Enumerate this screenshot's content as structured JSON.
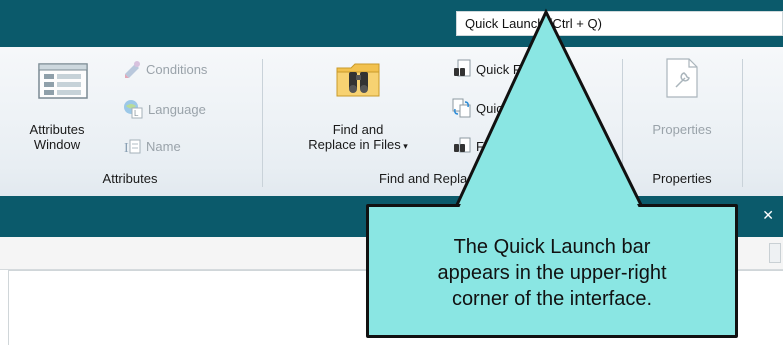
{
  "quick_launch": {
    "text": "Quick Launch (Ctrl + Q)"
  },
  "ribbon": {
    "attributes_group": {
      "window_button": {
        "line1": "Attributes",
        "line2": "Window"
      },
      "conditions": "Conditions",
      "language": "Language",
      "name": "Name",
      "group_label": "Attributes"
    },
    "find_group": {
      "find_in_files": {
        "line1": "Find and",
        "line2": "Replace in Files"
      },
      "quick_find": "Quick Find",
      "quick_replace": "Quick Replace",
      "find_elements": "Find Elements",
      "group_label": "Find and Replace"
    },
    "properties_group": {
      "properties_button": "Properties",
      "group_label": "Properties"
    }
  },
  "callout": {
    "line1": "The Quick Launch bar",
    "line2": "appears in the upper-right",
    "line3": "corner of the interface."
  },
  "colors": {
    "topbar": "#0b5a6b",
    "callout_fill": "#8ae6e3"
  }
}
